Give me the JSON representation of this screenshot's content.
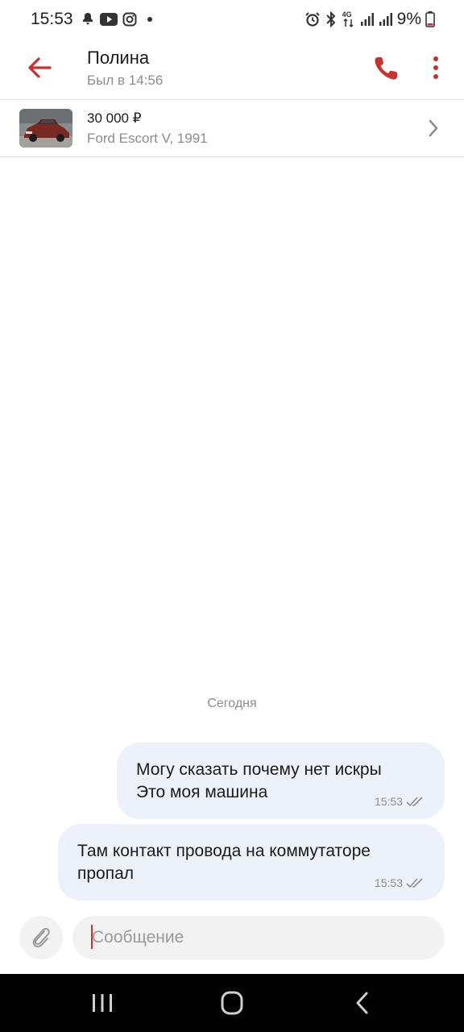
{
  "status_bar": {
    "time": "15:53",
    "network": "4G",
    "battery": "9%",
    "icons": [
      "notification-icon",
      "youtube-icon",
      "instagram-icon",
      "dot-icon",
      "alarm-icon",
      "bluetooth-icon",
      "network-4g-icon",
      "signal-icon",
      "signal-icon",
      "battery-icon"
    ]
  },
  "header": {
    "name": "Полина",
    "status": "Был в 14:56"
  },
  "listing": {
    "price": "30 000 ₽",
    "title": "Ford Escort V, 1991"
  },
  "chat": {
    "date_divider": "Сегодня",
    "messages": [
      {
        "text": "Могу сказать почему нет искры\nЭто моя машина",
        "time": "15:53",
        "read": true
      },
      {
        "text": "Там контакт провода на коммутаторе\nпропал",
        "time": "15:53",
        "read": true
      }
    ]
  },
  "composer": {
    "placeholder": "Сообщение"
  },
  "colors": {
    "accent": "#c8312e",
    "bubble": "#edf2fa",
    "muted_text": "#8c8c8c",
    "input_bg": "#f2f2f2"
  }
}
